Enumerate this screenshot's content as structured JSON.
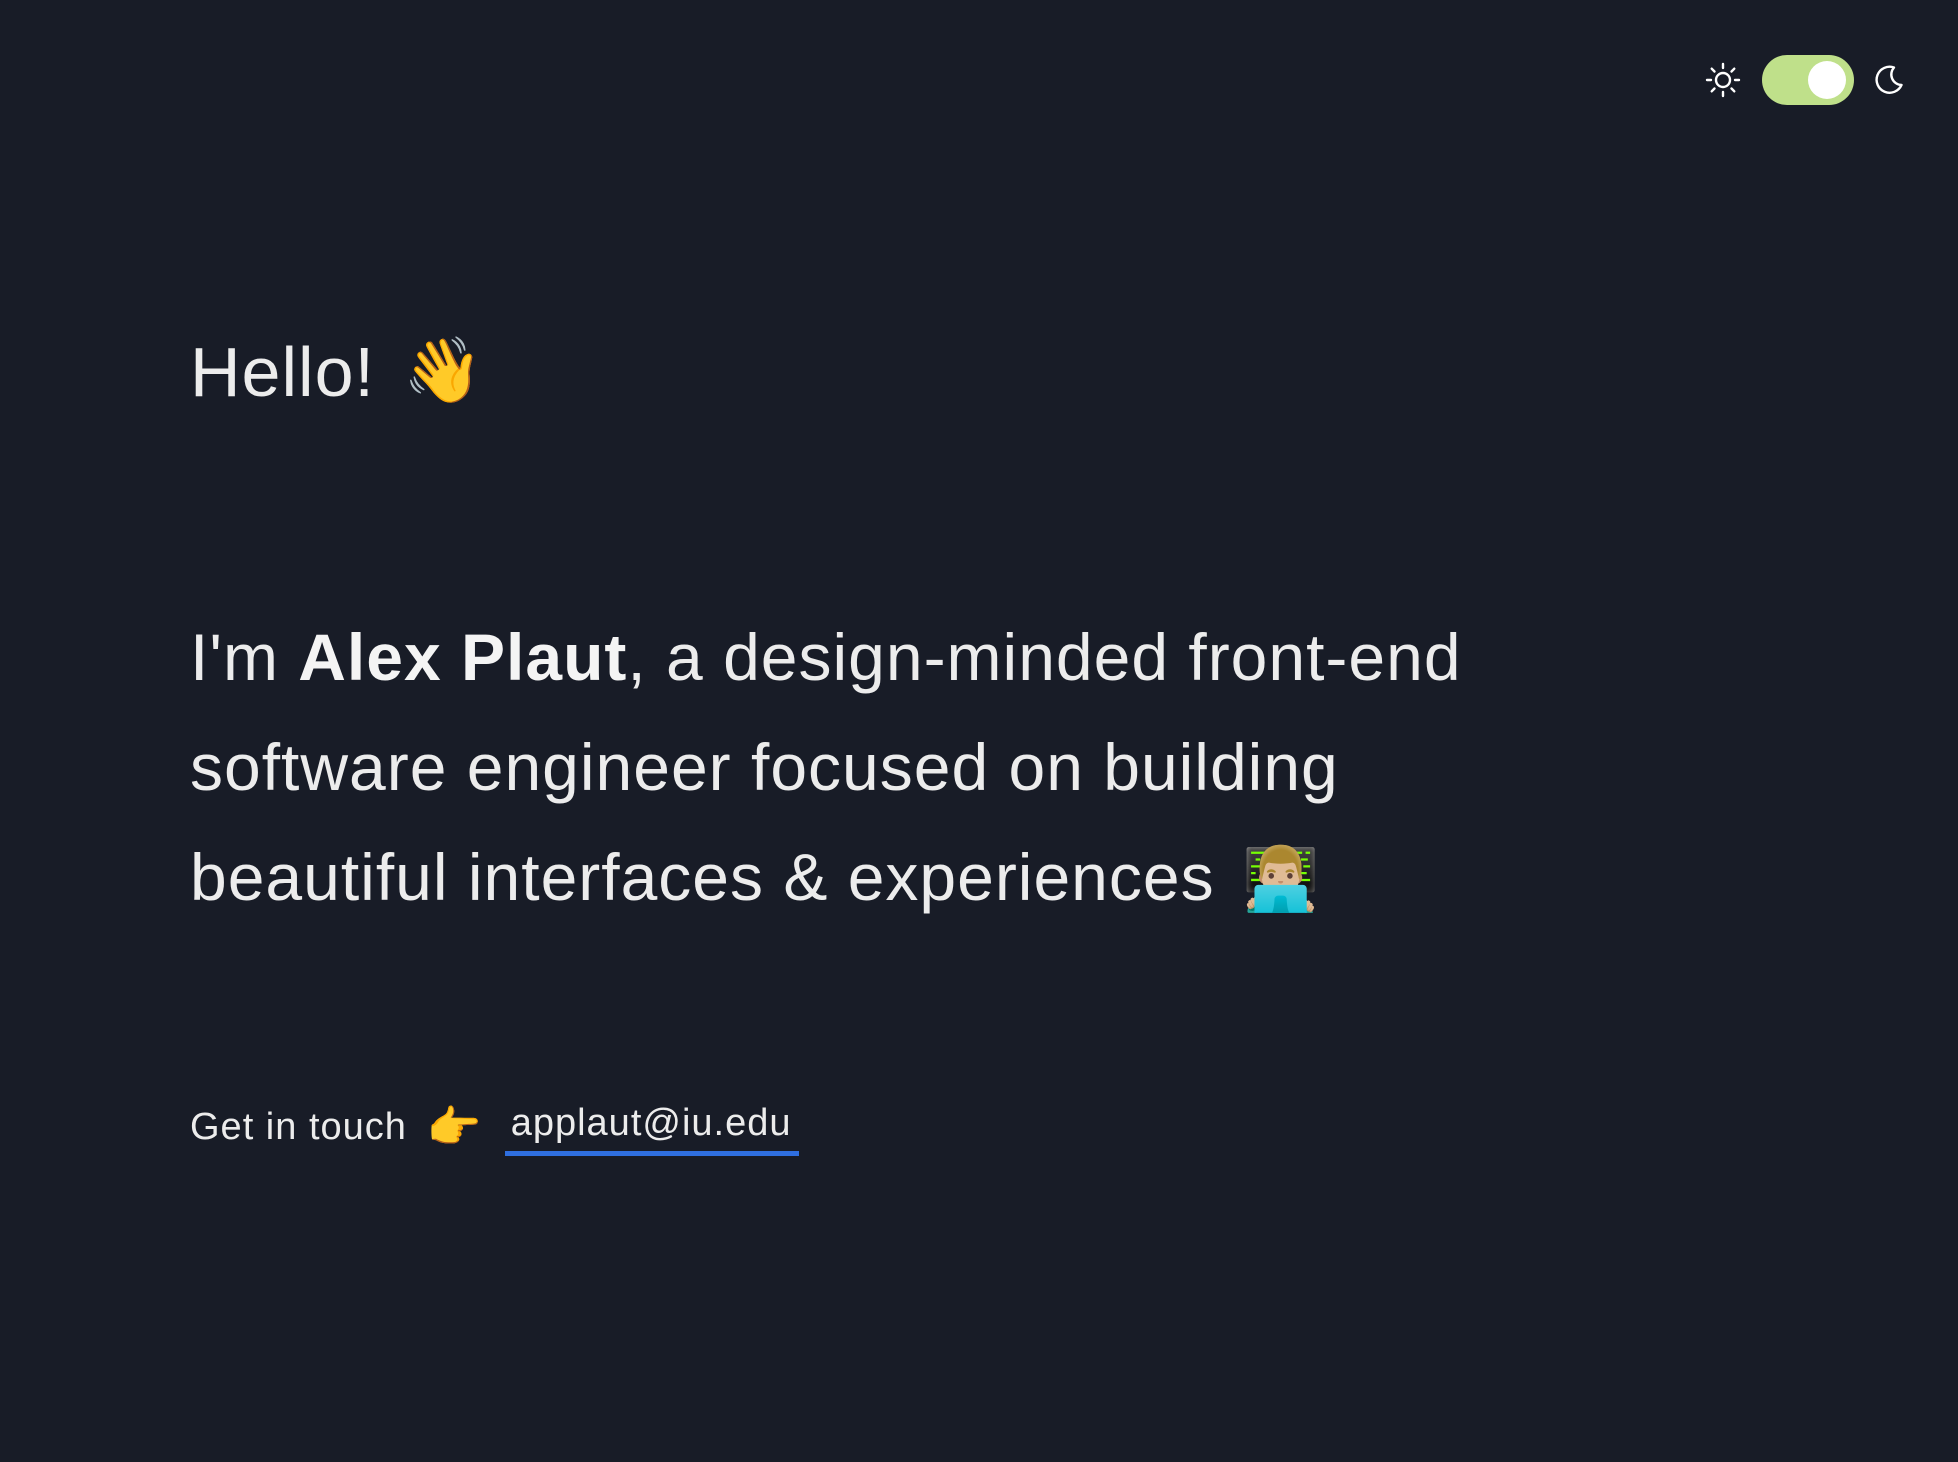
{
  "theme_toggle": {
    "light_icon": "sun-icon",
    "dark_icon": "moon-icon",
    "state": "on",
    "track_color": "#bfe08a",
    "knob_color": "#ffffff"
  },
  "greeting": {
    "text": "Hello!",
    "emoji": "👋"
  },
  "intro": {
    "prefix": "I'm ",
    "name": "Alex Plaut",
    "line1_suffix": ", a design-minded front-end",
    "line2": "software engineer focused on building",
    "line3": "beautiful interfaces & experiences",
    "emoji": "👨🏼‍💻"
  },
  "contact": {
    "label": "Get in touch",
    "emoji": "👉",
    "email": "applaut@iu.edu",
    "underline_color": "#2f6fe0"
  },
  "colors": {
    "background": "#181c27",
    "text": "#ececec"
  }
}
